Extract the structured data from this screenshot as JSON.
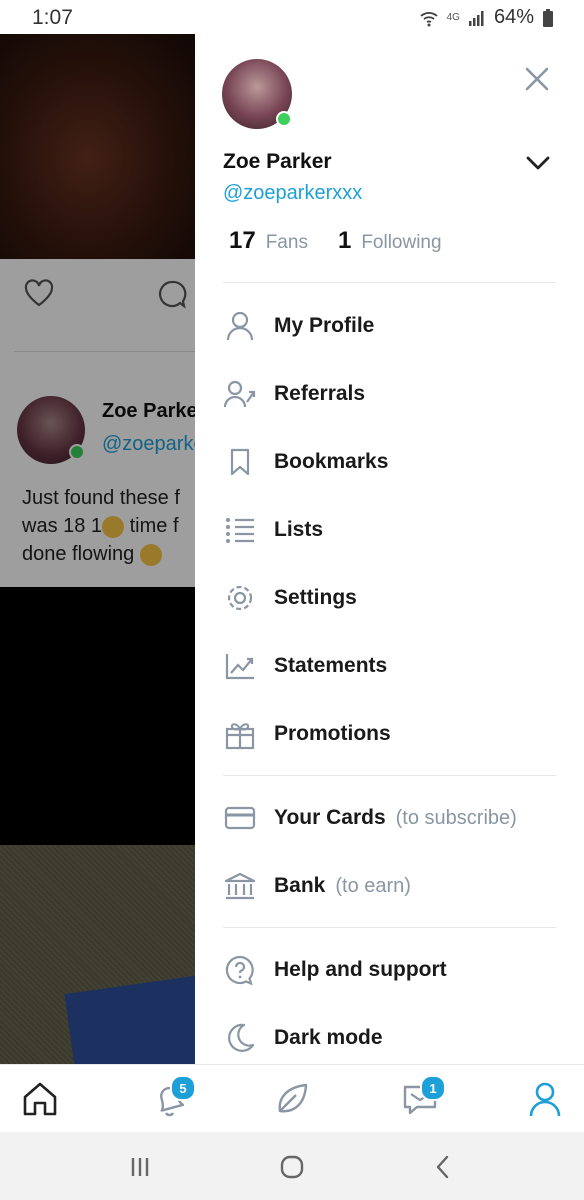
{
  "status_bar": {
    "time": "1:07",
    "network": "4G",
    "battery": "64%"
  },
  "feed": {
    "post_author_name": "Zoe Parker",
    "post_author_handle": "@zoeparkerxxx",
    "post_text_line1": "Just found these f",
    "post_text_line2": "was 18 1",
    "post_text_line2_b": " time f",
    "post_text_line3": "done flowing "
  },
  "drawer": {
    "name": "Zoe Parker",
    "handle": "@zoeparkerxxx",
    "fans_count": "17",
    "fans_label": "Fans",
    "following_count": "1",
    "following_label": "Following",
    "menu": [
      {
        "label": "My Profile",
        "icon": "user-icon"
      },
      {
        "label": "Referrals",
        "icon": "referrals-icon"
      },
      {
        "label": "Bookmarks",
        "icon": "bookmark-icon"
      },
      {
        "label": "Lists",
        "icon": "list-icon"
      },
      {
        "label": "Settings",
        "icon": "gear-icon"
      },
      {
        "label": "Statements",
        "icon": "chart-icon"
      },
      {
        "label": "Promotions",
        "icon": "gift-icon"
      }
    ],
    "payment_menu": [
      {
        "label": "Your Cards",
        "sub": "(to subscribe)",
        "icon": "card-icon"
      },
      {
        "label": "Bank",
        "sub": "(to earn)",
        "icon": "bank-icon"
      }
    ],
    "help_menu": [
      {
        "label": "Help and support",
        "icon": "help-icon"
      },
      {
        "label": "Dark mode",
        "icon": "moon-icon"
      }
    ]
  },
  "bottom_nav": {
    "notifications_badge": "5",
    "messages_badge": "1"
  },
  "colors": {
    "accent": "#1da0d8",
    "muted": "#8a96a3",
    "online": "#3ccf5b"
  }
}
